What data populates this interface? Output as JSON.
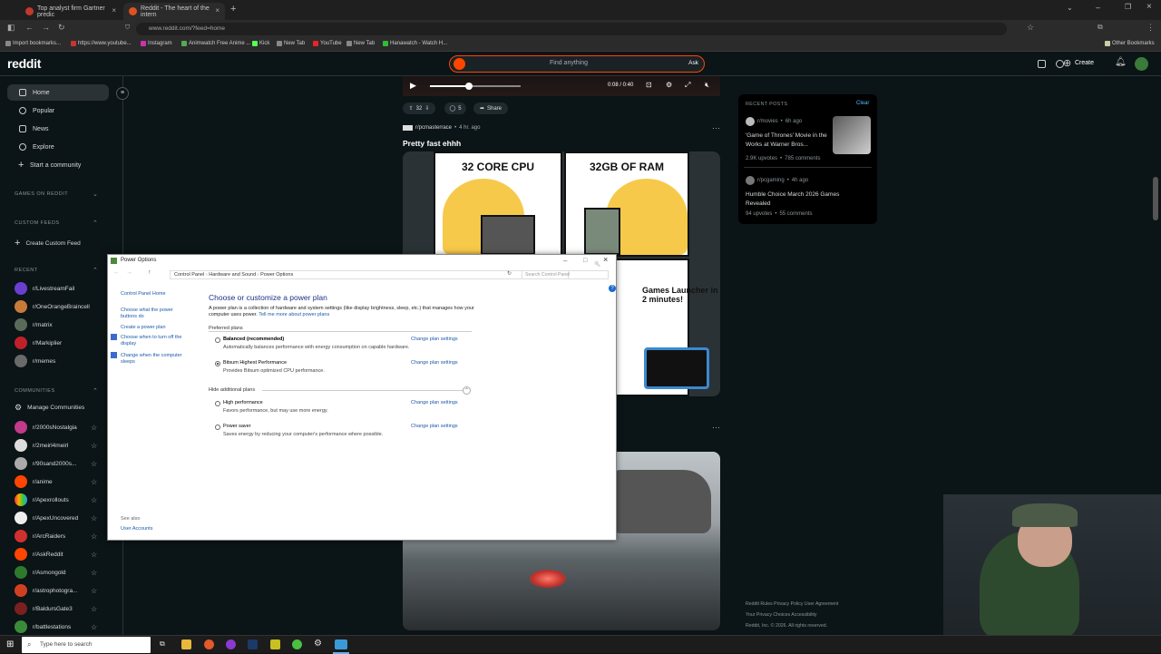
{
  "browser": {
    "tabs": [
      {
        "title": "Top analyst firm Gartner predic",
        "active": false
      },
      {
        "title": "Reddit - The heart of the intern",
        "active": true
      }
    ],
    "url": "www.reddit.com/?feed=home",
    "bookmarks": [
      "Import bookmarks...",
      "https://www.youtube...",
      "Instagram",
      "Animwatch Free Anime ...",
      "Kick",
      "New Tab",
      "YouTube",
      "New Tab",
      "Hanawatch - Watch H..."
    ],
    "other_bookmarks": "Other Bookmarks"
  },
  "reddit": {
    "logo": "reddit",
    "search_placeholder": "Find anything",
    "ask_label": "Ask",
    "create_label": "Create",
    "nav": [
      {
        "label": "Home",
        "active": true
      },
      {
        "label": "Popular",
        "active": false
      },
      {
        "label": "News",
        "active": false
      },
      {
        "label": "Explore",
        "active": false
      },
      {
        "label": "Start a community",
        "active": false
      }
    ],
    "sections": {
      "games": "GAMES ON REDDIT",
      "custom": "CUSTOM FEEDS",
      "create_custom": "Create Custom Feed",
      "recent": "RECENT",
      "communities": "COMMUNITIES",
      "manage": "Manage Communities"
    },
    "recent": [
      "r/LivestreamFail",
      "r/OneOrangeBraincell",
      "r/matrix",
      "r/Markiplier",
      "r/memes"
    ],
    "communities": [
      "r/2000sNostalgia",
      "r/2meirl4meirl",
      "r/90sand2000s...",
      "r/anime",
      "r/Apexrollouts",
      "r/ApexUncovered",
      "r/ArcRaiders",
      "r/AskReddit",
      "r/Asmongold",
      "r/astrophotogra...",
      "r/BaldursGate3",
      "r/battlestations"
    ]
  },
  "feed": {
    "video_time": "0:08 / 0:40",
    "votes": "32",
    "comments": "5",
    "share": "Share",
    "post_sub": "r/pcmasterrace",
    "post_time": "4 hr. ago",
    "post_title": "Pretty fast ehhh",
    "meme_left": "32 CORE CPU",
    "meme_right": "32GB OF RAM",
    "meme_bottom": "Games Launcher in 2 minutes!"
  },
  "recent_posts": {
    "title": "RECENT POSTS",
    "clear": "Clear",
    "items": [
      {
        "sub": "r/movies",
        "time": "6h ago",
        "title": "'Game of Thrones' Movie in the Works at Warner Bros...",
        "upvotes": "2.9K upvotes",
        "comments": "785 comments"
      },
      {
        "sub": "r/pcgaming",
        "time": "4h ago",
        "title": "Humble Choice March 2026 Games Revealed",
        "upvotes": "94 upvotes",
        "comments": "55 comments"
      }
    ]
  },
  "footer": {
    "line1": "Reddit Rules   Privacy Policy   User Agreement",
    "line2": "Your Privacy Choices   Accessibility",
    "line3": "Reddit, Inc. © 2026. All rights reserved."
  },
  "control_panel": {
    "window_title": "Power Options",
    "breadcrumb": [
      "Control Panel",
      "Hardware and Sound",
      "Power Options"
    ],
    "search_placeholder": "Search Control Panel",
    "left_links": [
      "Control Panel Home",
      "Choose what the power buttons do",
      "Create a power plan",
      "Choose when to turn off the display",
      "Change when the computer sleeps"
    ],
    "see_also": "See also",
    "user_accounts": "User Accounts",
    "heading": "Choose or customize a power plan",
    "description": "A power plan is a collection of hardware and system settings (like display brightness, sleep, etc.) that manages how your computer uses power.",
    "learn_more": "Tell me more about power plans",
    "preferred": "Preferred plans",
    "hide_additional": "Hide additional plans",
    "change_settings": "Change plan settings",
    "plans": [
      {
        "name": "Balanced (recommended)",
        "desc": "Automatically balances performance with energy consumption on capable hardware.",
        "selected": false,
        "bold": true
      },
      {
        "name": "Bitsum Highest Performance",
        "desc": "Provides Bitsum optimized CPU performance.",
        "selected": true,
        "bold": false
      },
      {
        "name": "High performance",
        "desc": "Favors performance, but may use more energy.",
        "selected": false,
        "bold": false
      },
      {
        "name": "Power saver",
        "desc": "Saves energy by reducing your computer's performance where possible.",
        "selected": false,
        "bold": false
      }
    ]
  },
  "taskbar": {
    "search_placeholder": "Type here to search"
  }
}
